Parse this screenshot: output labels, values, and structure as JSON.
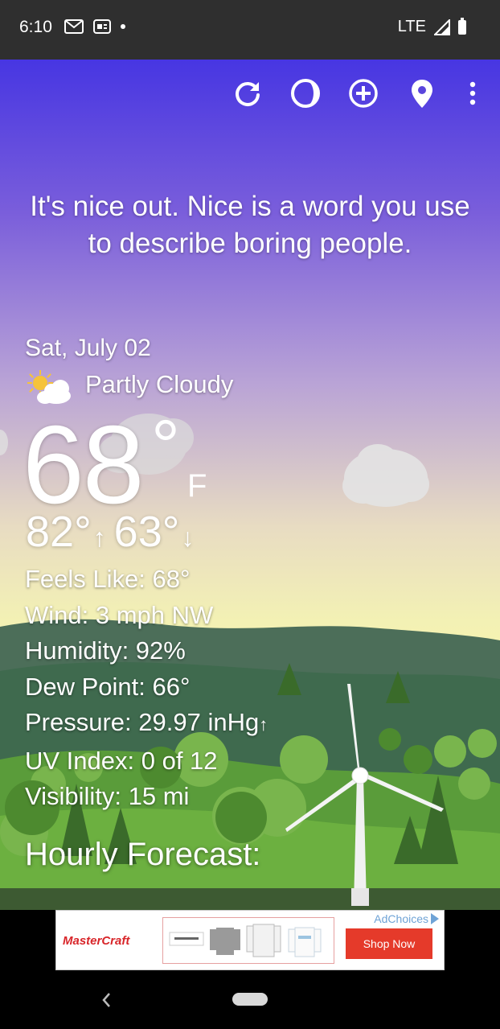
{
  "status_bar": {
    "time": "6:10",
    "network": "LTE",
    "icons": [
      "gmail-icon",
      "google-news-icon",
      "notification-dot-icon",
      "signal-icon",
      "battery-icon"
    ]
  },
  "toolbar": {
    "icons": [
      "refresh-icon",
      "theme-icon",
      "add-location-icon",
      "location-pin-icon",
      "more-options-icon"
    ]
  },
  "quote": "It's nice out. Nice is a word you use to describe boring people.",
  "weather": {
    "date": "Sat, July 02",
    "condition": "Partly Cloudy",
    "condition_icon": "partly-cloudy-icon",
    "temperature": "68",
    "degree_symbol": "°",
    "unit": "F",
    "high": "82°",
    "high_arrow": "↑",
    "low": "63°",
    "low_arrow": "↓"
  },
  "details": {
    "feels_like": "Feels Like:  68°",
    "wind": "Wind:  3 mph NW",
    "humidity": "Humidity:  92%",
    "dew_point": "Dew Point:  66°",
    "pressure": "Pressure:  29.97 inHg",
    "pressure_trend": "↑",
    "uv_index": "UV Index:  0 of 12",
    "visibility": "Visibility:  15 mi"
  },
  "hourly_heading": "Hourly Forecast:",
  "ad": {
    "brand": "MasterCraft",
    "choices_label": "AdChoices",
    "cta": "Shop Now"
  },
  "colors": {
    "sky_top": "#4736e2",
    "sky_bottom": "#f6f3ae",
    "ad_cta": "#e53a2a",
    "ad_brand": "#d8262a"
  }
}
